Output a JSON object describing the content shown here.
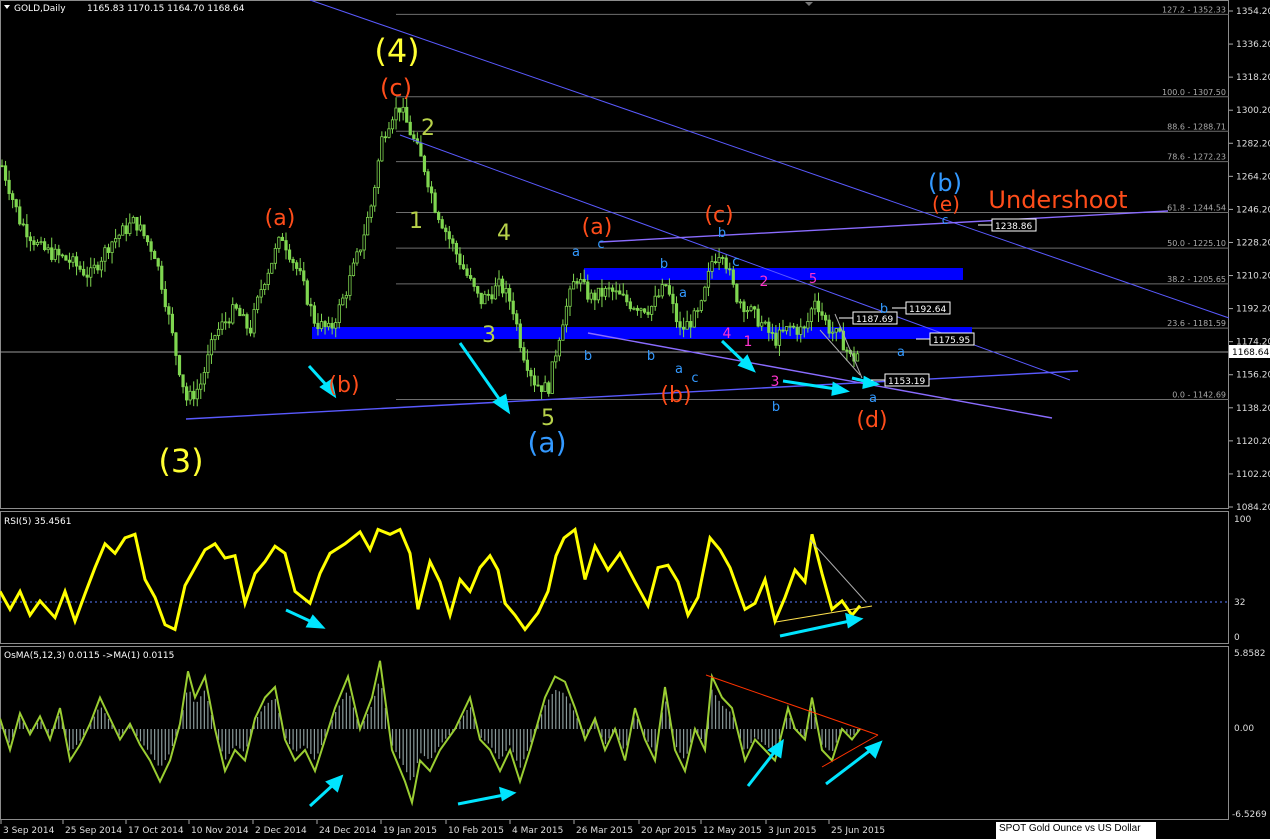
{
  "chart_header": {
    "symbol": "GOLD,Daily",
    "ohlc": "1165.83 1170.15 1164.70 1168.64"
  },
  "colors": {
    "background": "#000000",
    "candles": "#7fd650",
    "rsi": "#ffff00",
    "osma_line": "#9acd32",
    "trend_lines": "#5555ff",
    "zones": "#0000ff",
    "arrows": "#00e5ff",
    "labels_yellow": "#ffff33",
    "labels_red": "#ff4d1a",
    "labels_blue": "#3399ff",
    "labels_green": "#b8d24a",
    "labels_magenta": "#ff33cc"
  },
  "price_axis": {
    "ylim": [
      1084.2,
      1354.2
    ],
    "ticks": [
      "1354.20",
      "1336.20",
      "1318.20",
      "1300.20",
      "1282.20",
      "1264.20",
      "1246.20",
      "1228.20",
      "1210.20",
      "1192.20",
      "1174.20",
      "1156.20",
      "1138.20",
      "1120.20",
      "1102.20",
      "1084.20"
    ],
    "current_price": "1168.64"
  },
  "fib_levels": [
    {
      "label": "127.2 - 1352.33",
      "price": 1352.33
    },
    {
      "label": "100.0 - 1307.50",
      "price": 1307.5
    },
    {
      "label": "88.6 - 1288.71",
      "price": 1288.71
    },
    {
      "label": "78.6 - 1272.23",
      "price": 1272.23
    },
    {
      "label": "61.8 - 1244.54",
      "price": 1244.54
    },
    {
      "label": "50.0 - 1225.10",
      "price": 1225.1
    },
    {
      "label": "38.2 - 1205.65",
      "price": 1205.65
    },
    {
      "label": "23.6 - 1181.59",
      "price": 1181.59
    },
    {
      "label": "0.0 - 1142.69",
      "price": 1142.69
    }
  ],
  "price_tags": [
    {
      "text": "1238.86",
      "price": 1238.86
    },
    {
      "text": "1192.64",
      "price": 1192.64
    },
    {
      "text": "1187.69",
      "price": 1187.69
    },
    {
      "text": "1175.95",
      "price": 1175.95
    },
    {
      "text": "1153.19",
      "price": 1153.19
    }
  ],
  "wave_labels": [
    {
      "text": "(4)",
      "color": "yellow"
    },
    {
      "text": "(c)",
      "color": "red"
    },
    {
      "text": "(3)",
      "color": "yellow"
    },
    {
      "text": "(a)",
      "color": "red"
    },
    {
      "text": "(b)",
      "color": "red"
    },
    {
      "text": "2",
      "color": "green"
    },
    {
      "text": "1",
      "color": "green"
    },
    {
      "text": "4",
      "color": "green"
    },
    {
      "text": "3",
      "color": "green"
    },
    {
      "text": "5",
      "color": "green"
    },
    {
      "text": "(a)",
      "color": "blue"
    },
    {
      "text": "(a)",
      "color": "red"
    },
    {
      "text": "(c)",
      "color": "red"
    },
    {
      "text": "(b)",
      "color": "red"
    },
    {
      "text": "(d)",
      "color": "red"
    },
    {
      "text": "(b)",
      "color": "blue"
    },
    {
      "text": "(e)",
      "color": "red"
    },
    {
      "text": "Undershoot",
      "color": "red"
    },
    {
      "text": "a",
      "color": "blue"
    },
    {
      "text": "c",
      "color": "blue"
    },
    {
      "text": "b",
      "color": "blue"
    },
    {
      "text": "b",
      "color": "blue"
    },
    {
      "text": "a",
      "color": "blue"
    },
    {
      "text": "b",
      "color": "blue"
    },
    {
      "text": "a",
      "color": "blue"
    },
    {
      "text": "c",
      "color": "blue"
    },
    {
      "text": "b",
      "color": "blue"
    },
    {
      "text": "c",
      "color": "blue"
    },
    {
      "text": "2",
      "color": "magenta"
    },
    {
      "text": "4",
      "color": "magenta"
    },
    {
      "text": "1",
      "color": "magenta"
    },
    {
      "text": "3",
      "color": "magenta"
    },
    {
      "text": "5",
      "color": "magenta"
    },
    {
      "text": "b",
      "color": "blue"
    },
    {
      "text": "a",
      "color": "blue"
    },
    {
      "text": "b",
      "color": "blue"
    },
    {
      "text": "a",
      "color": "blue"
    },
    {
      "text": "c",
      "color": "blue"
    },
    {
      "text": "c",
      "color": "blue"
    }
  ],
  "rsi": {
    "header": "RSI(5) 35.4561",
    "ticks": [
      "100",
      "32",
      "0"
    ],
    "level": 32
  },
  "osma": {
    "header": "OsMA(5,12,3) 0.0115  ->MA(1) 0.0115",
    "ticks": [
      "5.8582",
      "0.00",
      "-6.5269"
    ]
  },
  "time_axis": [
    "3 Sep 2014",
    "25 Sep 2014",
    "17 Oct 2014",
    "10 Nov 2014",
    "2 Dec 2014",
    "24 Dec 2014",
    "19 Jan 2015",
    "10 Feb 2015",
    "4 Mar 2015",
    "26 Mar 2015",
    "20 Apr 2015",
    "12 May 2015",
    "3 Jun 2015",
    "25 Jun 2015"
  ],
  "status_bar": "SPOT Gold Ounce vs US Dollar",
  "chart_data": {
    "type": "candlestick",
    "ylim": [
      1084.2,
      1354.2
    ],
    "x_start": "3 Sep 2014",
    "x_end": "2 Jul 2015",
    "close_path": [
      [
        "3 Sep 2014",
        1270
      ],
      [
        "15 Sep 2014",
        1228
      ],
      [
        "25 Sep 2014",
        1218
      ],
      [
        "3 Oct 2014",
        1240
      ],
      [
        "10 Oct 2014",
        1222
      ],
      [
        "17 Oct 2014",
        1200
      ],
      [
        "24 Oct 2014",
        1188
      ],
      [
        "31 Oct 2014",
        1165
      ],
      [
        "5 Nov 2014",
        1140
      ],
      [
        "10 Nov 2014",
        1152
      ],
      [
        "17 Nov 2014",
        1180
      ],
      [
        "24 Nov 2014",
        1195
      ],
      [
        "28 Nov 2014",
        1178
      ],
      [
        "2 Dec 2014",
        1205
      ],
      [
        "10 Dec 2014",
        1230
      ],
      [
        "15 Dec 2014",
        1210
      ],
      [
        "24 Dec 2014",
        1178
      ],
      [
        "2 Jan 2015",
        1190
      ],
      [
        "9 Jan 2015",
        1220
      ],
      [
        "14 Jan 2015",
        1260
      ],
      [
        "19 Jan 2015",
        1285
      ],
      [
        "22 Jan 2015",
        1302
      ],
      [
        "28 Jan 2015",
        1280
      ],
      [
        "2 Feb 2015",
        1265
      ],
      [
        "10 Feb 2015",
        1236
      ],
      [
        "17 Feb 2015",
        1210
      ],
      [
        "24 Feb 2015",
        1200
      ],
      [
        "2 Mar 2015",
        1210
      ],
      [
        "10 Mar 2015",
        1165
      ],
      [
        "17 Mar 2015",
        1150
      ],
      [
        "23 Mar 2015",
        1185
      ],
      [
        "26 Mar 2015",
        1205
      ],
      [
        "2 Apr 2015",
        1200
      ],
      [
        "10 Apr 2015",
        1195
      ],
      [
        "20 Apr 2015",
        1190
      ],
      [
        "28 Apr 2015",
        1180
      ],
      [
        "5 May 2015",
        1192
      ],
      [
        "12 May 2015",
        1205
      ],
      [
        "18 May 2015",
        1225
      ],
      [
        "22 May 2015",
        1205
      ],
      [
        "27 May 2015",
        1185
      ],
      [
        "3 Jun 2015",
        1180
      ],
      [
        "10 Jun 2015",
        1183
      ],
      [
        "18 Jun 2015",
        1200
      ],
      [
        "22 Jun 2015",
        1180
      ],
      [
        "25 Jun 2015",
        1175
      ],
      [
        "30 Jun 2015",
        1168.64
      ]
    ]
  }
}
